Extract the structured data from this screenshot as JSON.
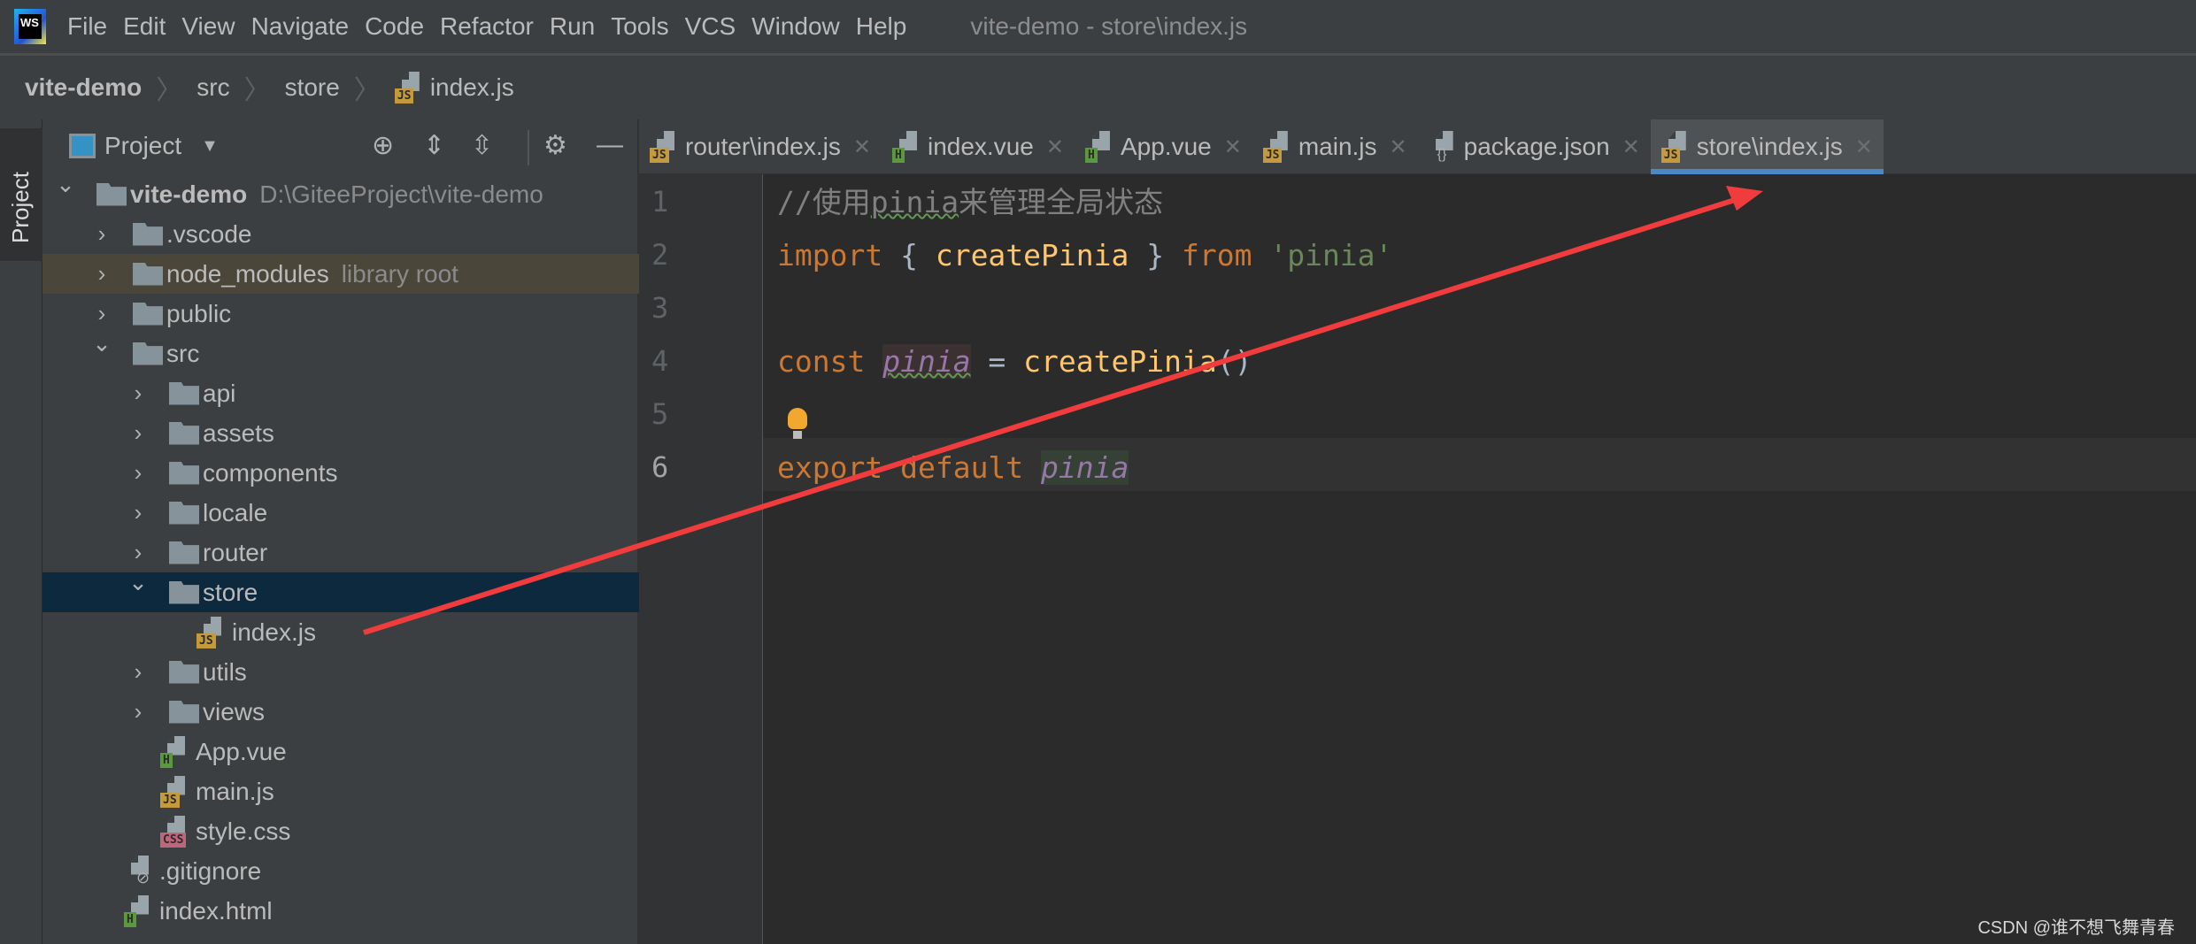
{
  "app": {
    "logo_text": "WS",
    "window_title": "vite-demo - store\\index.js"
  },
  "menu": [
    "File",
    "Edit",
    "View",
    "Navigate",
    "Code",
    "Refactor",
    "Run",
    "Tools",
    "VCS",
    "Window",
    "Help"
  ],
  "breadcrumb": [
    "vite-demo",
    "src",
    "store",
    "index.js"
  ],
  "side_stripe": {
    "label": "Project"
  },
  "panel": {
    "title": "Project"
  },
  "tree": [
    {
      "label": "vite-demo",
      "hint": "D:\\GiteeProject\\vite-demo",
      "level": 0,
      "type": "folder",
      "expanded": true,
      "bold": true
    },
    {
      "label": ".vscode",
      "level": 1,
      "type": "folder",
      "expanded": false
    },
    {
      "label": "node_modules",
      "hint": "library root",
      "level": 1,
      "type": "folder",
      "expanded": false,
      "library": true
    },
    {
      "label": "public",
      "level": 1,
      "type": "folder",
      "expanded": false
    },
    {
      "label": "src",
      "level": 1,
      "type": "folder",
      "expanded": true
    },
    {
      "label": "api",
      "level": 2,
      "type": "folder",
      "expanded": false
    },
    {
      "label": "assets",
      "level": 2,
      "type": "folder",
      "expanded": false
    },
    {
      "label": "components",
      "level": 2,
      "type": "folder",
      "expanded": false
    },
    {
      "label": "locale",
      "level": 2,
      "type": "folder",
      "expanded": false
    },
    {
      "label": "router",
      "level": 2,
      "type": "folder",
      "expanded": false
    },
    {
      "label": "store",
      "level": 2,
      "type": "folder",
      "expanded": true,
      "selected": true
    },
    {
      "label": "index.js",
      "level": 3,
      "type": "js"
    },
    {
      "label": "utils",
      "level": 2,
      "type": "folder",
      "expanded": false
    },
    {
      "label": "views",
      "level": 2,
      "type": "folder",
      "expanded": false
    },
    {
      "label": "App.vue",
      "level": 2,
      "type": "h"
    },
    {
      "label": "main.js",
      "level": 2,
      "type": "js"
    },
    {
      "label": "style.css",
      "level": 2,
      "type": "css"
    },
    {
      "label": ".gitignore",
      "level": 1,
      "type": "ignore"
    },
    {
      "label": "index.html",
      "level": 1,
      "type": "h"
    }
  ],
  "tabs": [
    {
      "label": "router\\index.js",
      "type": "js"
    },
    {
      "label": "index.vue",
      "type": "h"
    },
    {
      "label": "App.vue",
      "type": "h"
    },
    {
      "label": "main.js",
      "type": "js"
    },
    {
      "label": "package.json",
      "type": "json"
    },
    {
      "label": "store\\index.js",
      "type": "js",
      "active": true
    }
  ],
  "code": {
    "current_line": 6,
    "lines": [
      [
        {
          "t": "//使用",
          "c": "cm"
        },
        {
          "t": "pinia",
          "c": "cm wavy"
        },
        {
          "t": "来管理全局状态",
          "c": "cm"
        }
      ],
      [
        {
          "t": "import",
          "c": "kw"
        },
        {
          "t": " { ",
          "c": "pl"
        },
        {
          "t": "createPinia",
          "c": "fn"
        },
        {
          "t": " } ",
          "c": "pl"
        },
        {
          "t": "from",
          "c": "kw"
        },
        {
          "t": " 'pinia'",
          "c": "str"
        }
      ],
      [],
      [
        {
          "t": "const",
          "c": "kw"
        },
        {
          "t": " ",
          "c": "pl"
        },
        {
          "t": "pinia",
          "c": "var hl wavy"
        },
        {
          "t": " = ",
          "c": "pl"
        },
        {
          "t": "createPinia",
          "c": "fn"
        },
        {
          "t": "()",
          "c": "pl"
        }
      ],
      [],
      [
        {
          "t": "export",
          "c": "kw"
        },
        {
          "t": " ",
          "c": "pl"
        },
        {
          "t": "default",
          "c": "kw"
        },
        {
          "t": " ",
          "c": "pl"
        },
        {
          "t": "pinia",
          "c": "var hl2"
        }
      ]
    ]
  },
  "annotation": {
    "color": "#f03c3c"
  },
  "watermark": "CSDN @谁不想飞舞青春"
}
